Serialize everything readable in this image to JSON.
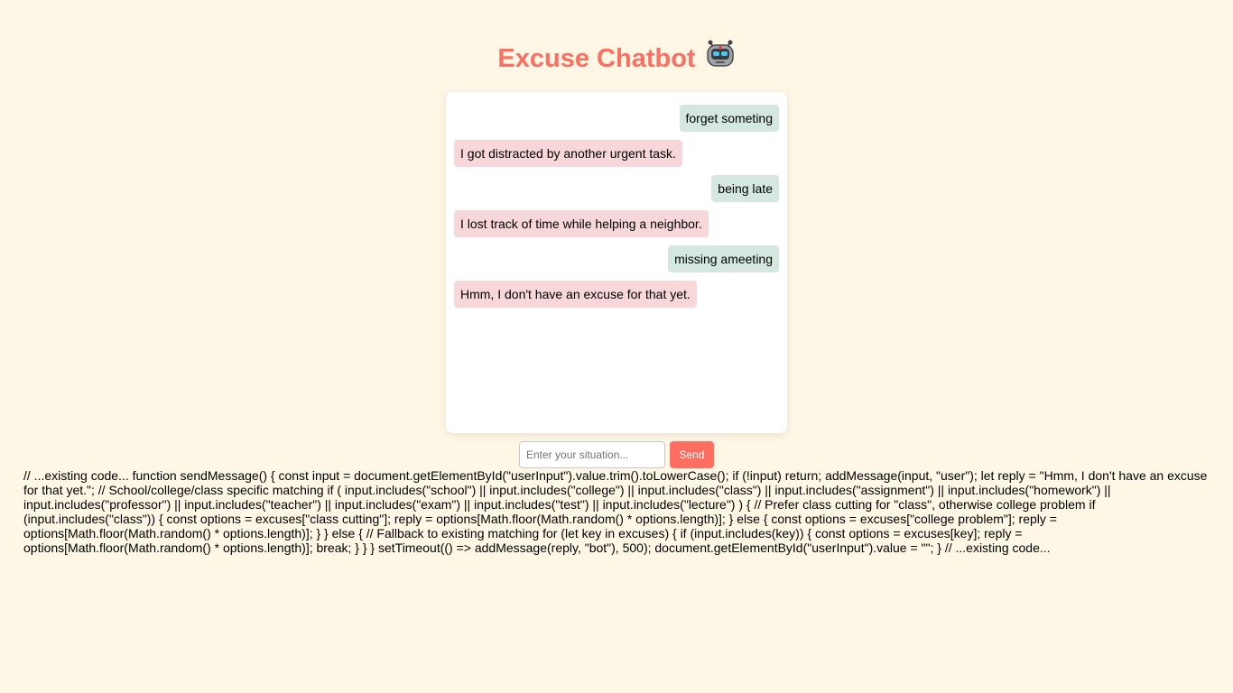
{
  "header": {
    "title": "Excuse Chatbot",
    "icon": "robot-icon"
  },
  "chat": {
    "messages": [
      {
        "sender": "user",
        "text": "forget someting"
      },
      {
        "sender": "bot",
        "text": "I got distracted by another urgent task."
      },
      {
        "sender": "user",
        "text": "being late"
      },
      {
        "sender": "bot",
        "text": "I lost track of time while helping a neighbor."
      },
      {
        "sender": "user",
        "text": "missing ameeting"
      },
      {
        "sender": "bot",
        "text": "Hmm, I don't have an excuse for that yet."
      }
    ]
  },
  "composer": {
    "placeholder": "Enter your situation...",
    "value": "",
    "send_label": "Send"
  },
  "code_text": "// ...existing code... function sendMessage() { const input = document.getElementById(\"userInput\").value.trim().toLowerCase(); if (!input) return; addMessage(input, \"user\"); let reply = \"Hmm, I don't have an excuse for that yet.\"; // School/college/class specific matching if ( input.includes(\"school\") || input.includes(\"college\") || input.includes(\"class\") || input.includes(\"assignment\") || input.includes(\"homework\") || input.includes(\"professor\") || input.includes(\"teacher\") || input.includes(\"exam\") || input.includes(\"test\") || input.includes(\"lecture\") ) { // Prefer class cutting for \"class\", otherwise college problem if (input.includes(\"class\")) { const options = excuses[\"class cutting\"]; reply = options[Math.floor(Math.random() * options.length)]; } else { const options = excuses[\"college problem\"]; reply = options[Math.floor(Math.random() * options.length)]; } } else { // Fallback to existing matching for (let key in excuses) { if (input.includes(key)) { const options = excuses[key]; reply = options[Math.floor(Math.random() * options.length)]; break; } } } setTimeout(() => addMessage(reply, \"bot\"), 500); document.getElementById(\"userInput\").value = \"\"; } // ...existing code...",
  "colors": {
    "background": "#fff7e6",
    "accent": "#ff6f61",
    "user_bubble": "#d4e8df",
    "bot_bubble": "#f8d7da"
  }
}
